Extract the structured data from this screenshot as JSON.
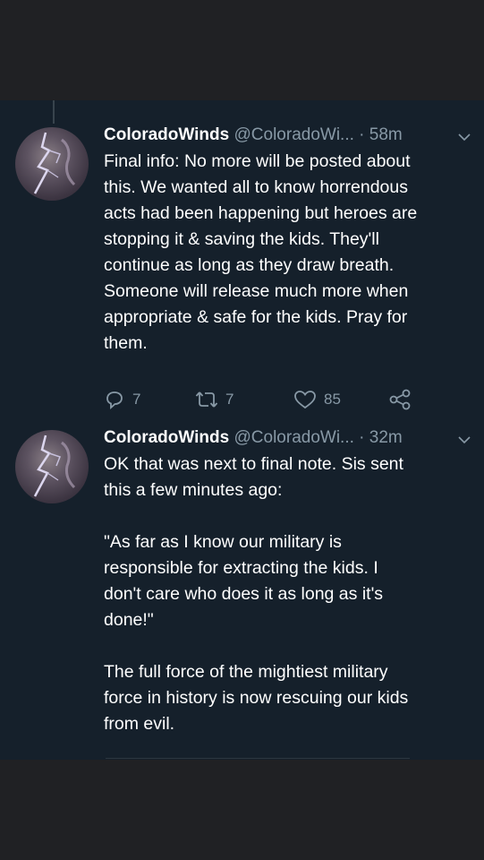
{
  "tweets": [
    {
      "display_name": "ColoradoWinds",
      "handle": "@ColoradoWi...",
      "separator": "·",
      "time": "58m",
      "text": "Final info: No more will be posted about\nthis. We wanted all to know horrendous\nacts had been happening but heroes are\nstopping it & saving the kids. They'll\ncontinue as long as they draw breath.\nSomeone will release much more when\nappropriate & safe for the kids. Pray for\nthem.",
      "reply_count": "7",
      "retweet_count": "7",
      "like_count": "85"
    },
    {
      "display_name": "ColoradoWinds",
      "handle": "@ColoradoWi...",
      "separator": "·",
      "time": "32m",
      "text": "OK that was next to final note. Sis sent\nthis a few minutes ago:\n\n\"As far as I know our military is\nresponsible for extracting the kids. I\ndon't care who does it as long as it's\ndone!\"\n\nThe full force of the mightiest military\nforce in history is now rescuing our kids\nfrom evil."
    }
  ],
  "colors": {
    "background": "#15202b",
    "frame": "#202124",
    "text": "#ffffff",
    "secondary": "#8899a6"
  },
  "icons": [
    "reply-icon",
    "retweet-icon",
    "like-icon",
    "share-icon",
    "chevron-down-icon"
  ]
}
